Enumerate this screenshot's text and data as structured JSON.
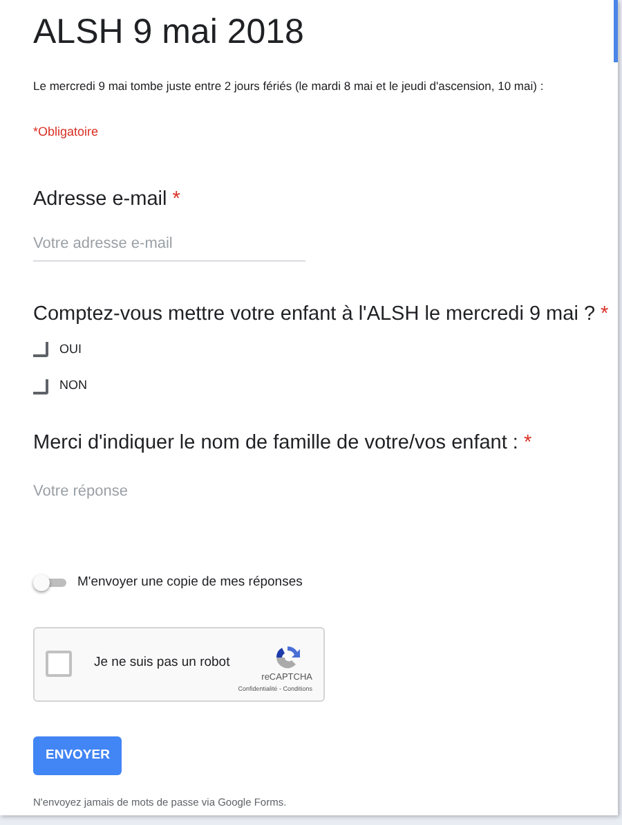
{
  "form": {
    "title": "ALSH 9 mai 2018",
    "description": "Le mercredi 9 mai tombe juste entre 2 jours fériés (le mardi 8 mai et le jeudi d'ascension, 10 mai) :",
    "required_note": "*Obligatoire"
  },
  "questions": [
    {
      "kind": "text",
      "label": "Adresse e-mail",
      "required_mark": "*",
      "placeholder": "Votre adresse e-mail",
      "underlined": true
    },
    {
      "kind": "checkboxes",
      "label": "Comptez-vous mettre votre enfant à l'ALSH le mercredi 9 mai ?",
      "required_mark": "*",
      "options": [
        {
          "label": "OUI",
          "checked": false
        },
        {
          "label": "NON",
          "checked": false
        }
      ]
    },
    {
      "kind": "text",
      "label": "Merci d'indiquer le nom de famille de votre/vos enfant :",
      "required_mark": "*",
      "placeholder": "Votre réponse",
      "underlined": false
    }
  ],
  "copy_toggle": {
    "label": "M'envoyer une copie de mes réponses",
    "on": false
  },
  "captcha": {
    "label": "Je ne suis pas un robot",
    "checked": false,
    "brand": "reCAPTCHA",
    "links": "Confidentialité - Conditions"
  },
  "submit": "ENVOYER",
  "footer": "N'envoyez jamais de mots de passe via Google Forms."
}
